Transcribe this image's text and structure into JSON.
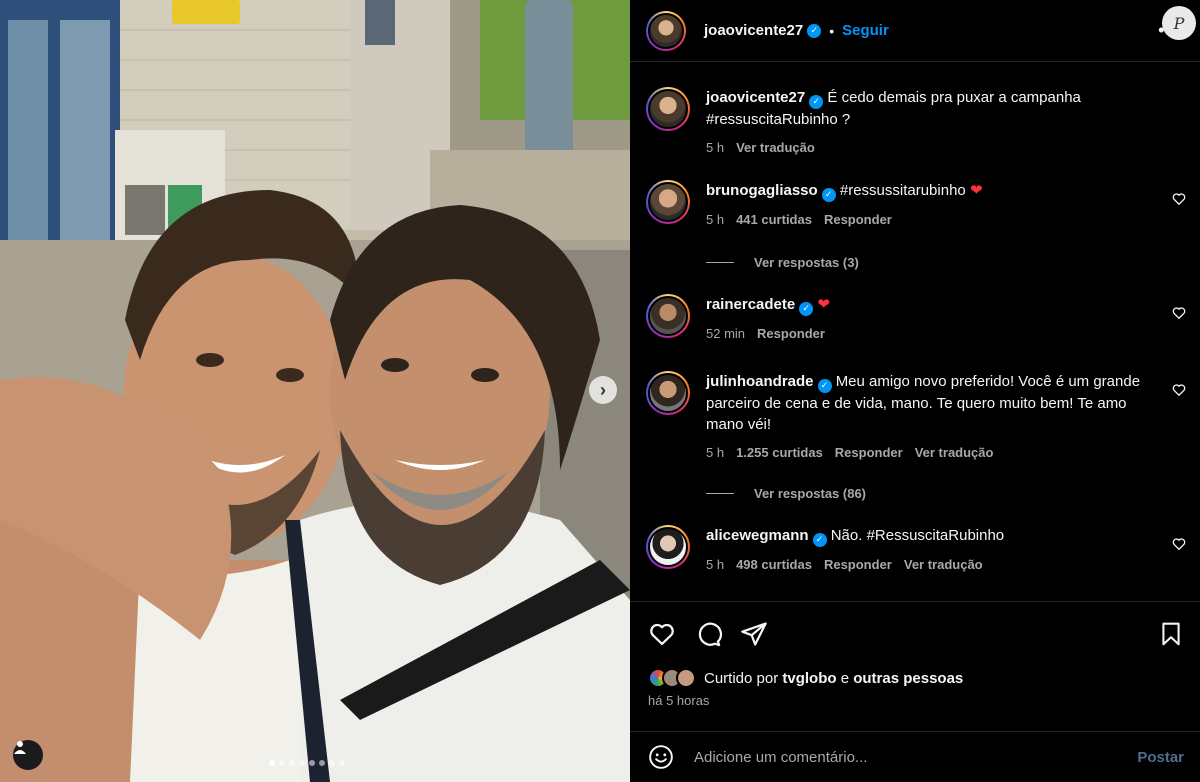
{
  "post": {
    "author": "joaovicente27",
    "separator": "•",
    "follow_label": "Seguir",
    "more_icon": "more-horizontal-icon",
    "watermark": "P",
    "carousel": {
      "slides": 8,
      "active_index": 0
    }
  },
  "caption": {
    "username": "joaovicente27",
    "text": "É cedo demais pra puxar a campanha #ressuscitaRubinho ?",
    "time": "5 h",
    "translate": "Ver tradução"
  },
  "comments": [
    {
      "username": "brunogagliasso",
      "text": "#ressussitarubinho",
      "heart": "❤",
      "time": "5 h",
      "likes": "441 curtidas",
      "reply": "Responder",
      "translate": "",
      "view_replies": "Ver respostas (3)"
    },
    {
      "username": "rainercadete",
      "text": "",
      "heart": "❤",
      "time": "52 min",
      "likes": "",
      "reply": "Responder",
      "translate": "",
      "view_replies": ""
    },
    {
      "username": "julinhoandrade",
      "text": "Meu amigo novo preferido! Você é um grande parceiro de cena e de vida, mano. Te quero muito bem! Te amo mano véi!",
      "heart": "",
      "time": "5 h",
      "likes": "1.255 curtidas",
      "reply": "Responder",
      "translate": "Ver tradução",
      "view_replies": "Ver respostas (86)"
    },
    {
      "username": "alicewegmann",
      "text": "Não. #RessuscitaRubinho",
      "heart": "",
      "time": "5 h",
      "likes": "498 curtidas",
      "reply": "Responder",
      "translate": "Ver tradução",
      "view_replies": ""
    }
  ],
  "actions": {
    "icons": [
      "heart-icon",
      "comment-icon",
      "share-icon",
      "bookmark-icon"
    ],
    "liked_by_prefix": "Curtido por",
    "liked_by_user": "tvglobo",
    "liked_by_conj": "e",
    "liked_by_others": "outras pessoas",
    "time_ago": "há 5 horas"
  },
  "add_comment": {
    "emoji_icon": "emoji-icon",
    "placeholder": "Adicione um comentário...",
    "post_label": "Postar"
  },
  "colors": {
    "background": "#000000",
    "accent_blue": "#0095f6",
    "muted_text": "#a8a8a8",
    "heart_red": "#ff3040"
  }
}
